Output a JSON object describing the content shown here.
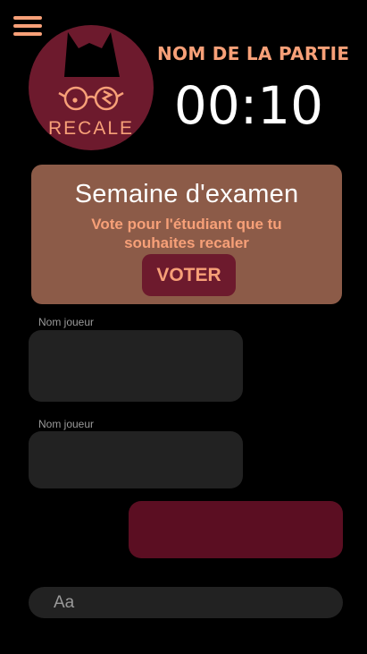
{
  "header": {
    "game_name": "NOM DE LA PARTIE",
    "timer": "00:10",
    "logo_text": "RECALE"
  },
  "event": {
    "title": "Semaine d'examen",
    "description": "Vote pour l'étudiant que tu souhaites recaler",
    "vote_button": "VOTER"
  },
  "messages": [
    {
      "player": "Nom joueur",
      "own": false
    },
    {
      "player": "Nom joueur",
      "own": false
    },
    {
      "player": "",
      "own": true
    }
  ],
  "chat": {
    "placeholder": "Aa"
  },
  "colors": {
    "accent": "#f7a078",
    "logo_circle": "#6d1a2d",
    "event_card": "#8c5b48",
    "own_bubble": "#5b0e22",
    "other_bubble": "#222222"
  }
}
